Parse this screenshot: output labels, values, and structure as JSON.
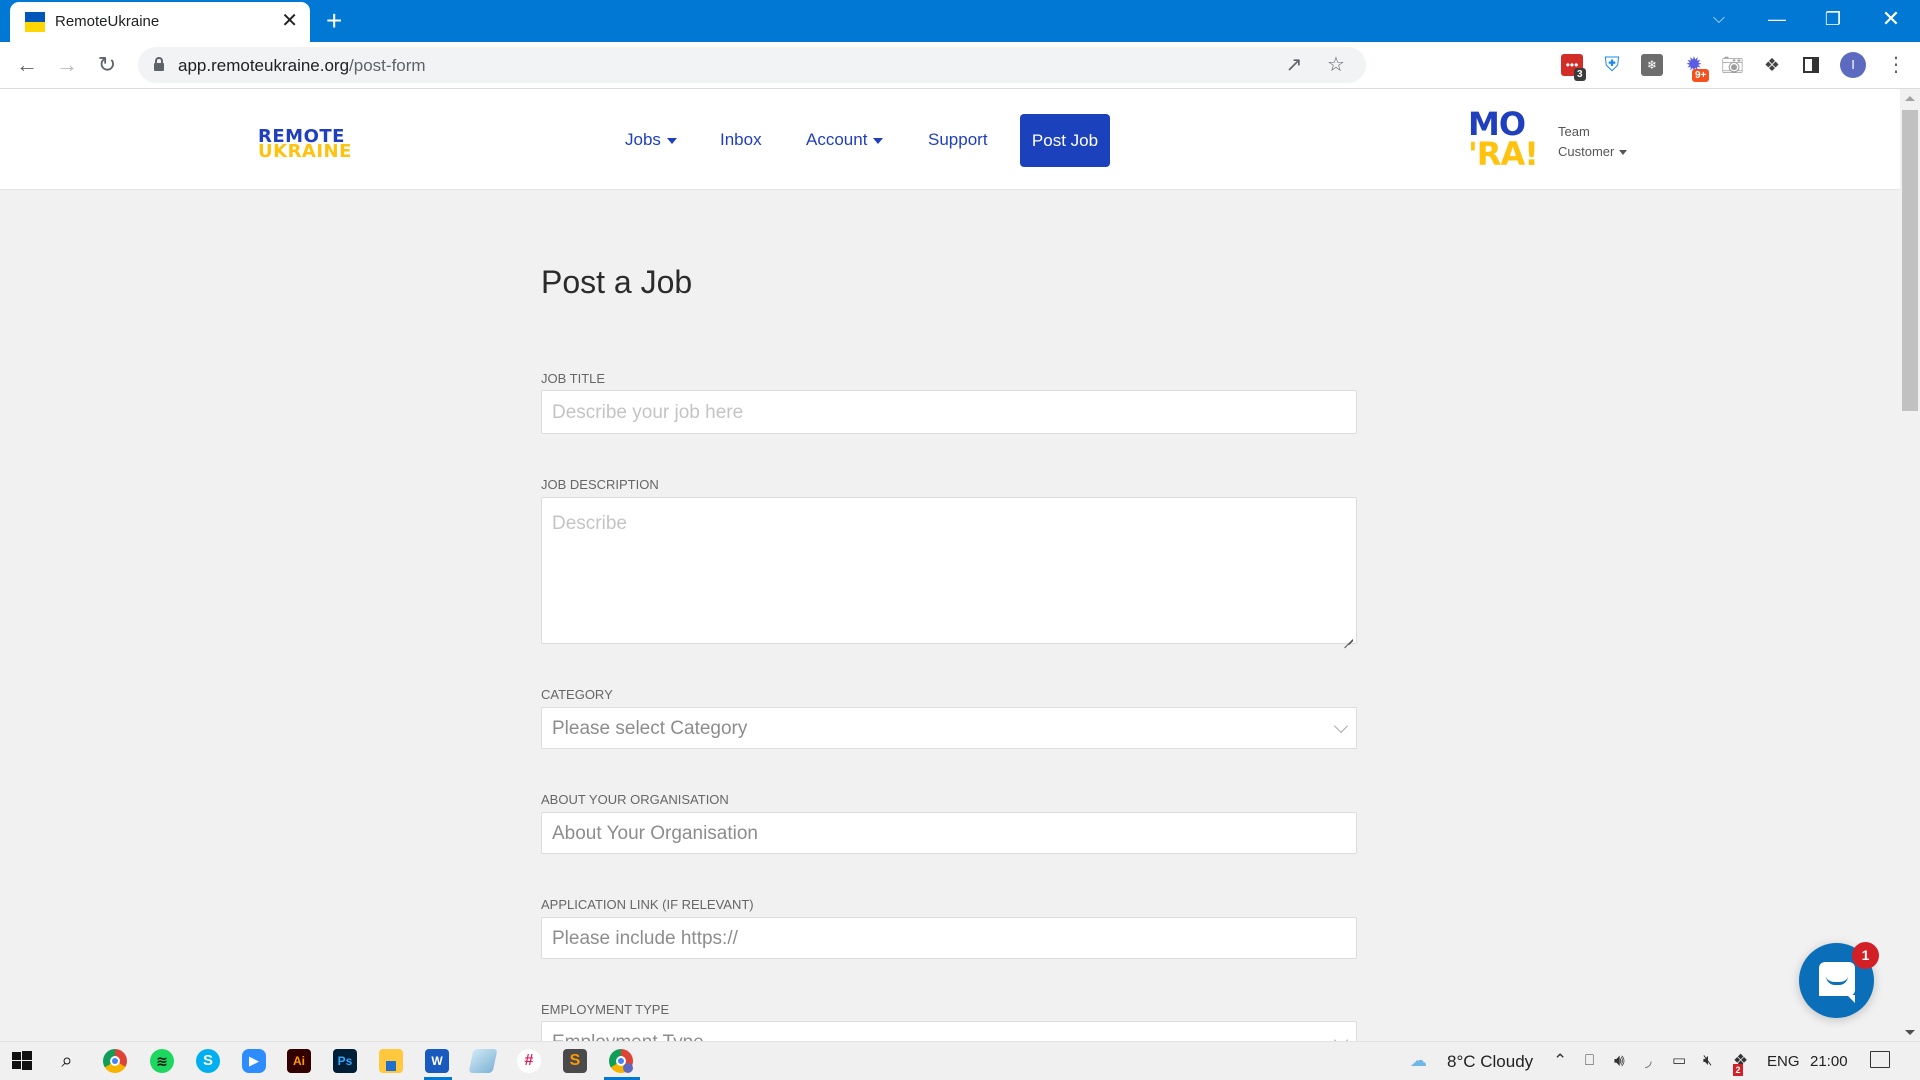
{
  "browser": {
    "tab_title": "RemoteUkraine",
    "tab_close": "✕",
    "new_tab": "+",
    "window_controls": {
      "tab_search": "⌵",
      "minimize": "—",
      "maximize": "❐",
      "close": "✕"
    },
    "url_domain": "app.remoteukraine.org",
    "url_path": "/post-form",
    "extensions": [
      {
        "name": "lastpass",
        "badge": "3",
        "color": "#d32d27"
      },
      {
        "name": "vpn-shield",
        "badge": "",
        "color": "#1e88e5"
      },
      {
        "name": "hubspot",
        "badge": "",
        "color": "#6d6d6d"
      },
      {
        "name": "burst",
        "badge": "9+",
        "color": "#5b5ce6"
      },
      {
        "name": "camera",
        "badge": "",
        "color": "#9e9e9e"
      }
    ],
    "profile_initial": "I"
  },
  "site": {
    "logo_line1": "REMOTE",
    "logo_line2": "UKRAINE",
    "nav": [
      {
        "label": "Jobs",
        "dropdown": true
      },
      {
        "label": "Inbox",
        "dropdown": false
      },
      {
        "label": "Account",
        "dropdown": true
      },
      {
        "label": "Support",
        "dropdown": false
      }
    ],
    "post_job_label": "Post Job",
    "org_logo_line1": "MO",
    "org_logo_line2": "'RA!",
    "user_line1": "Team",
    "user_line2": "Customer"
  },
  "form": {
    "title": "Post a Job",
    "fields": [
      {
        "label": "JOB TITLE",
        "placeholder": "Describe your job here",
        "type": "text"
      },
      {
        "label": "JOB DESCRIPTION",
        "placeholder": "Describe",
        "type": "textarea"
      },
      {
        "label": "CATEGORY",
        "placeholder": "Please select Category",
        "type": "select"
      },
      {
        "label": "ABOUT YOUR ORGANISATION",
        "placeholder": "About Your Organisation",
        "type": "text"
      },
      {
        "label": "APPLICATION LINK (IF RELEVANT)",
        "placeholder": "Please include https://",
        "type": "text"
      },
      {
        "label": "EMPLOYMENT TYPE",
        "placeholder": "Employment Type",
        "type": "select"
      }
    ]
  },
  "chat": {
    "unread_count": "1"
  },
  "taskbar": {
    "apps": [
      "windows-start",
      "search",
      "chrome",
      "spotify",
      "skype",
      "zoom",
      "illustrator",
      "photoshop",
      "file-explorer",
      "word",
      "notepad",
      "slack",
      "sublime-text",
      "chrome-profile"
    ],
    "weather": "8°C  Cloudy",
    "language": "ENG",
    "time": "21:00",
    "dropbox_badge": "2"
  },
  "colors": {
    "chrome_blue": "#0078d4",
    "brand_blue": "#1f3fbf",
    "brand_yellow": "#ffc20e",
    "button_blue": "#1c41bd",
    "chat_blue": "#0a6fb8",
    "badge_red": "#d32027"
  }
}
